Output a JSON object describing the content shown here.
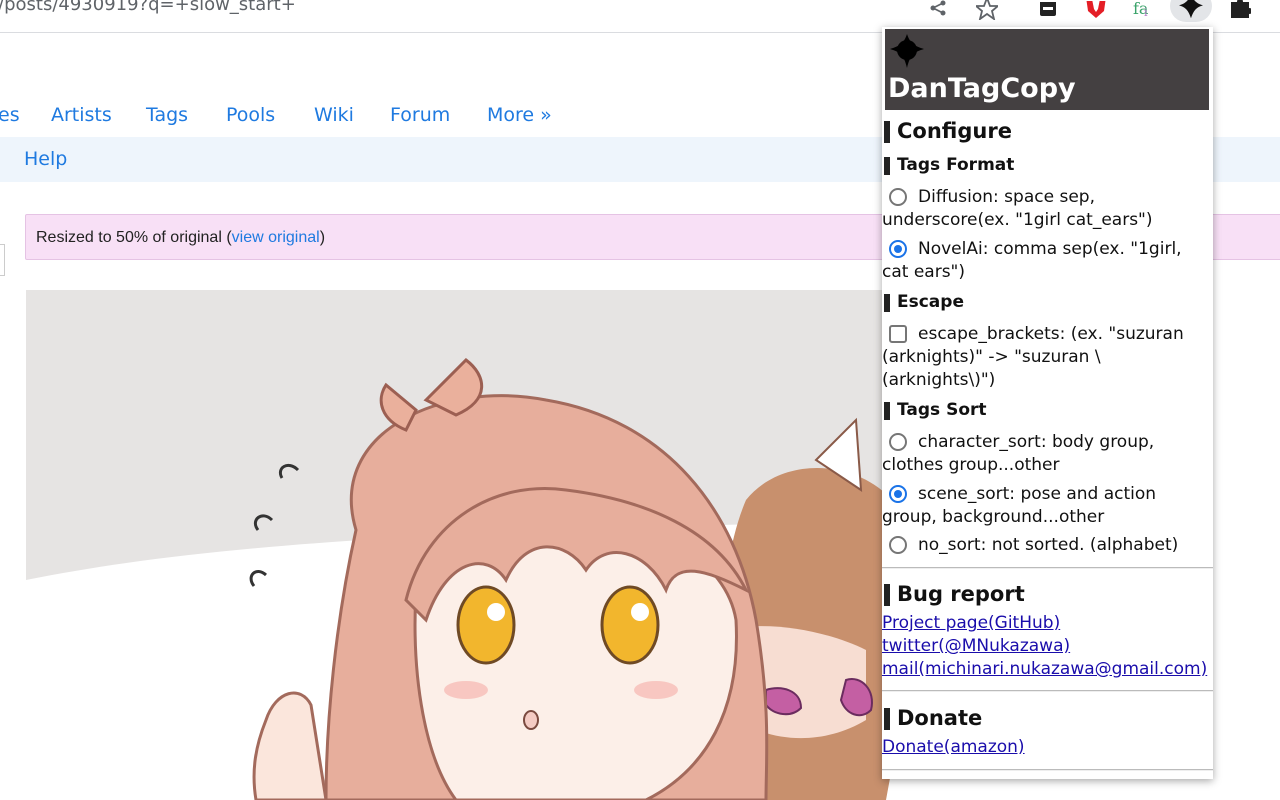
{
  "browser": {
    "url": "/posts/4930919?q=+slow_start+",
    "icons": [
      "share-icon",
      "bookmark-star-icon",
      "extension-dark-icon",
      "extension-red-icon",
      "extension-fa-icon",
      "dantagcopy-extension-icon",
      "extensions-puzzle-icon"
    ]
  },
  "site": {
    "nav": [
      "es",
      "Artists",
      "Tags",
      "Pools",
      "Wiki",
      "Forum",
      "More »"
    ],
    "subnav_help": "Help",
    "notice_prefix": "Resized to 50% of original (",
    "notice_link": "view original",
    "notice_suffix": ")"
  },
  "popup": {
    "title": "DanTagCopy",
    "configure": "Configure",
    "tags_format": {
      "heading": "Tags Format",
      "options": [
        {
          "label": "Diffusion: space sep, underscore(ex. \"1girl cat_ears\")",
          "checked": false
        },
        {
          "label": "NovelAi: comma sep(ex. \"1girl, cat ears\")",
          "checked": true
        }
      ]
    },
    "escape": {
      "heading": "Escape",
      "option": {
        "label": "escape_brackets: (ex. \"suzuran (arknights)\" -> \"suzuran \\(arknights\\)\")",
        "checked": false
      }
    },
    "tags_sort": {
      "heading": "Tags Sort",
      "options": [
        {
          "label": "character_sort: body group, clothes group...other",
          "checked": false
        },
        {
          "label": "scene_sort: pose and action group, background...other",
          "checked": true
        },
        {
          "label": "no_sort: not sorted. (alphabet)",
          "checked": false
        }
      ]
    },
    "bug_report": {
      "heading": "Bug report",
      "links": [
        "Project page(GitHub)",
        "twitter(@MNukazawa)",
        "mail(michinari.nukazawa@gmail.com)"
      ]
    },
    "donate": {
      "heading": "Donate",
      "link": "Donate(amazon)"
    }
  },
  "colors": {
    "link": "#1f7ae0",
    "header_bg": "#444041",
    "notice_bg": "#f8e0f6",
    "accent": "#1a73e8"
  }
}
